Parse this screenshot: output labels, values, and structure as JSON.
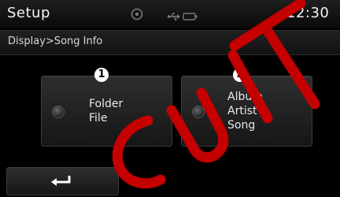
{
  "header": {
    "title": "Setup",
    "time": "12:30",
    "icons": [
      "disc-icon",
      "usb-icon",
      "battery-icon"
    ]
  },
  "breadcrumb": "Display>Song Info",
  "options": [
    {
      "number": "1",
      "lines": [
        "Folder",
        "File"
      ],
      "selected": false
    },
    {
      "number": "2",
      "lines": [
        "Album",
        "Artist",
        "Song"
      ],
      "selected": false
    }
  ],
  "back_button": {
    "icon": "back-arrow-icon"
  },
  "watermark": {
    "text": "CUTTA",
    "color": "#c40000"
  },
  "colors": {
    "background": "#000000",
    "button": "#262626",
    "text": "#e8e8e8",
    "badge": "#ffffff"
  }
}
